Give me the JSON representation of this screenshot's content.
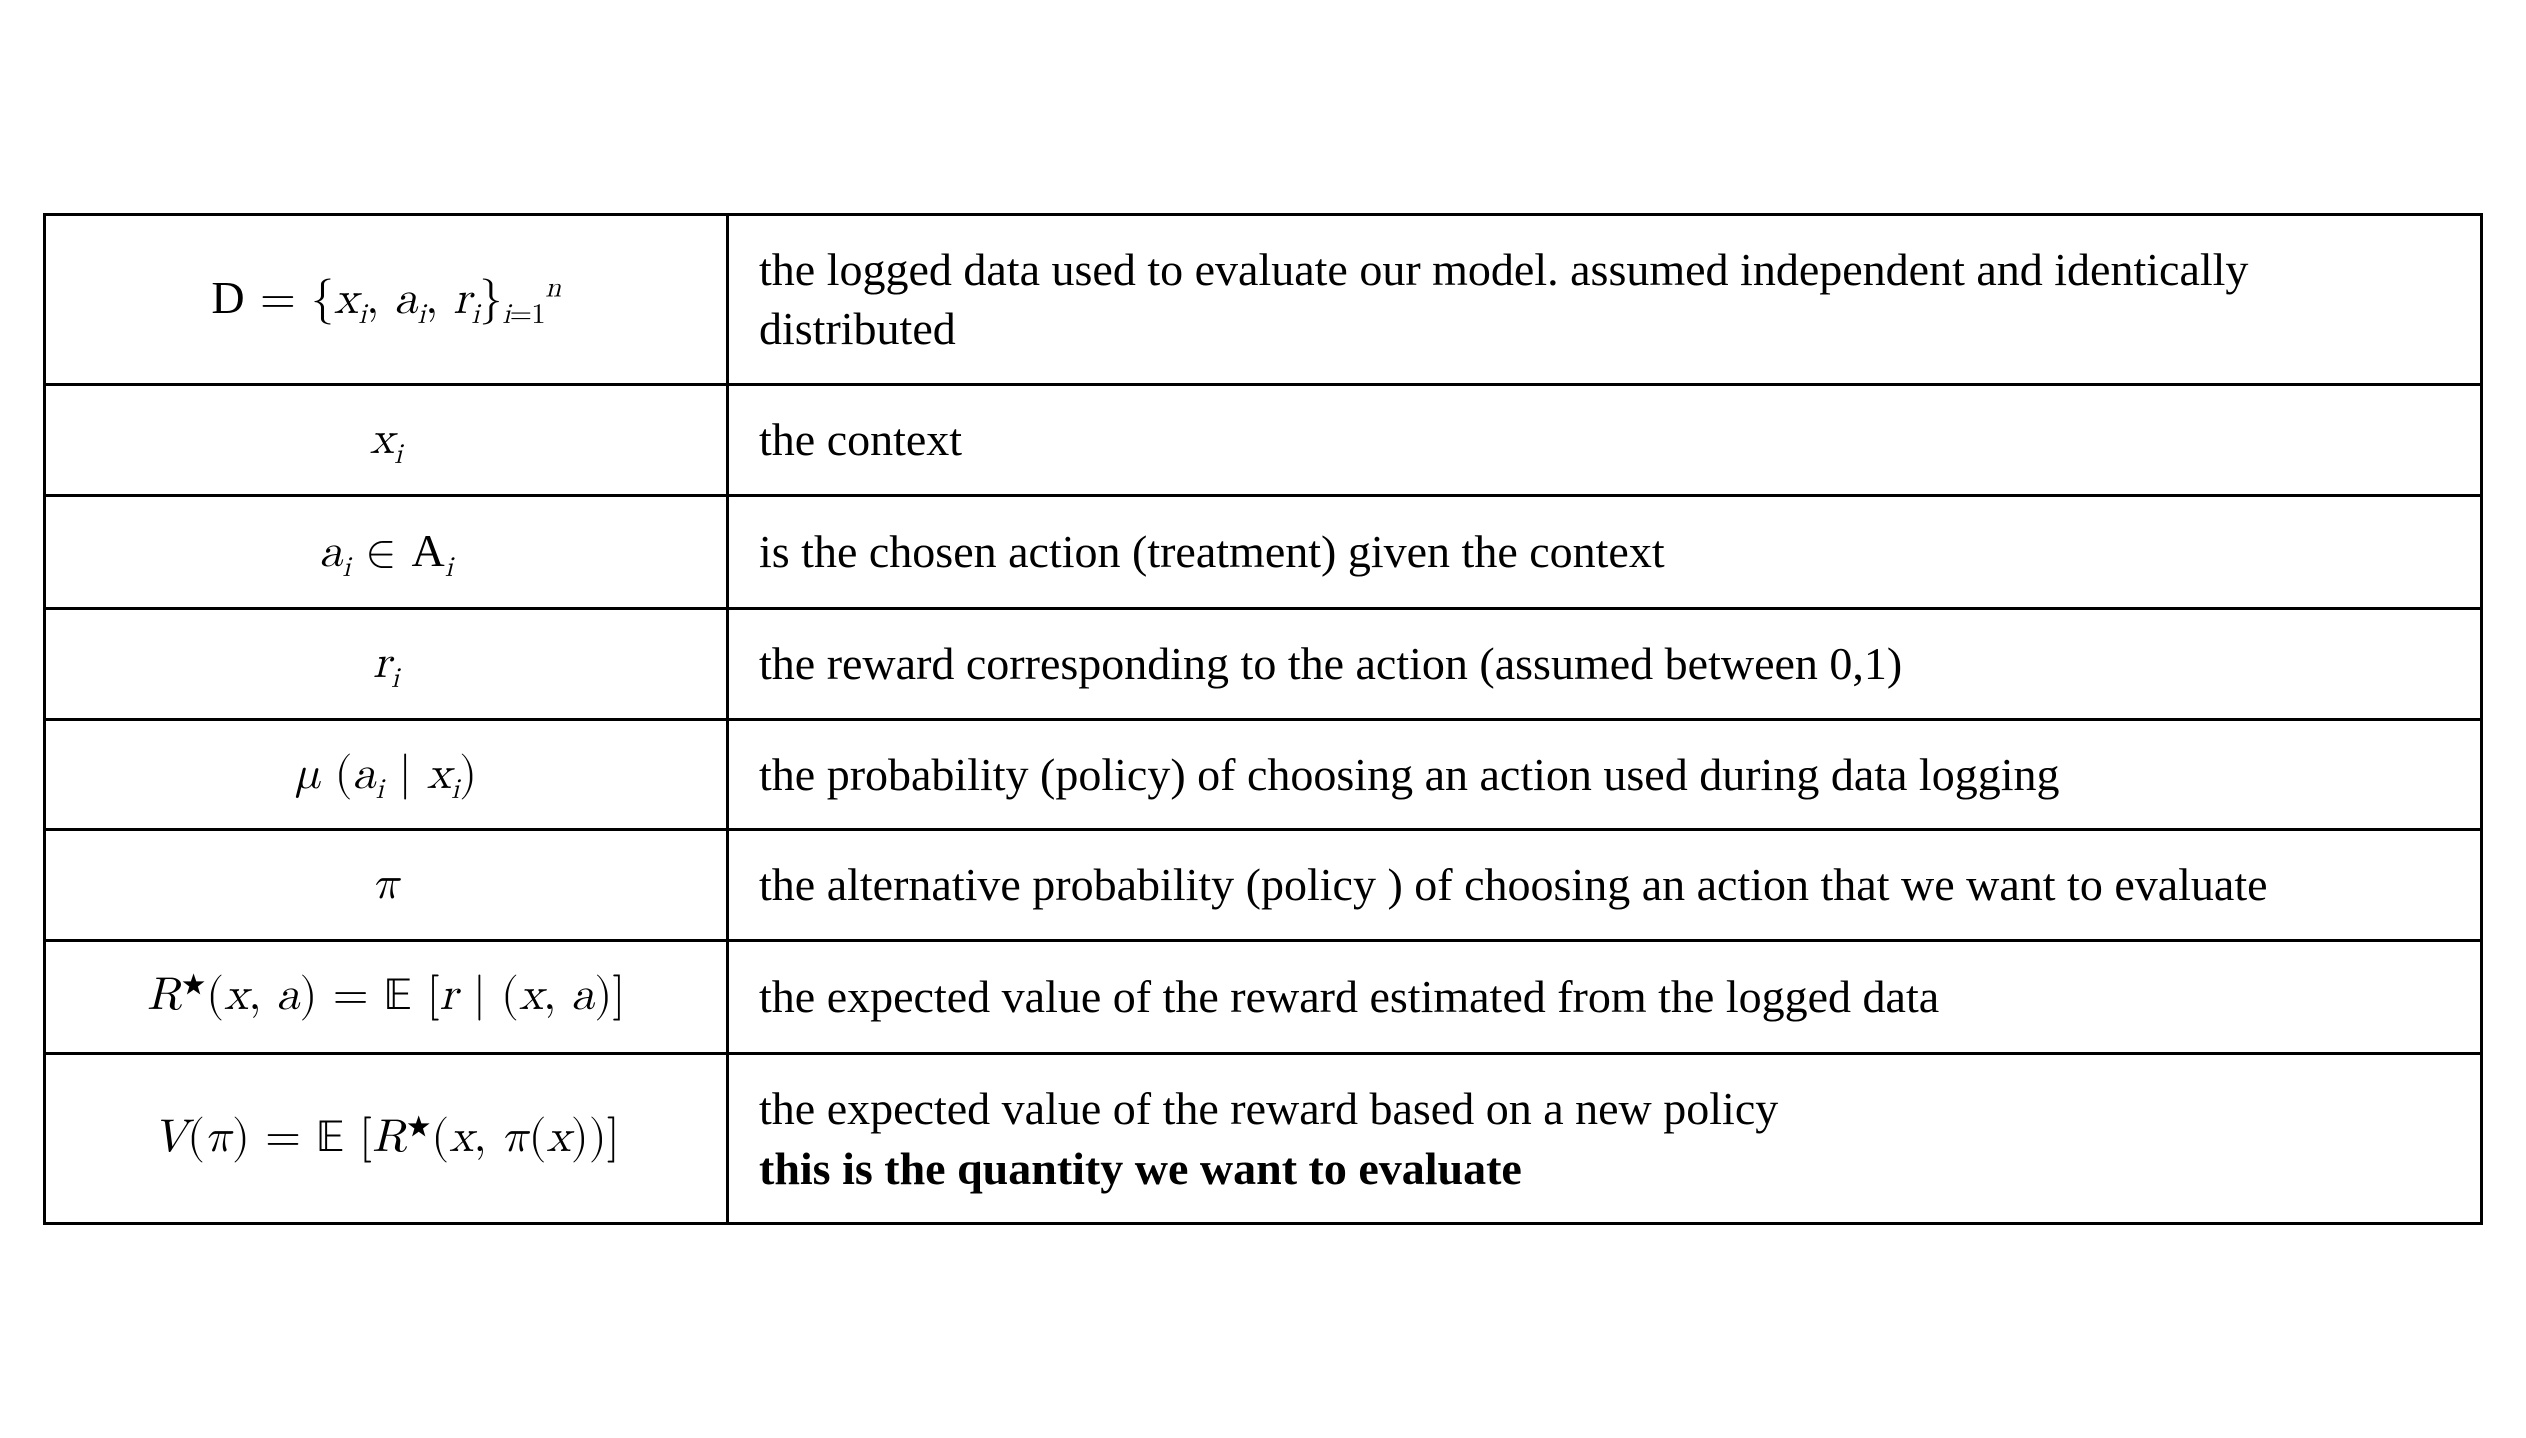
{
  "rows": [
    {
      "symbol_html": "<span class='cal'>D</span>&nbsp;<span class='up'>=</span>&nbsp;<span class='up'>{</span>x<sub>i</sub><span class='up'>,</span>&nbsp;a<sub>i</sub><span class='up'>,</span>&nbsp;r<sub>i</sub><span class='up'>}</span><span class='tight'><sub>i<span class='up'>=1</span></sub><sup>n</sup></span>",
      "description": "the logged data used to evaluate our model. assumed independent and identically distributed"
    },
    {
      "symbol_html": "x<sub>i</sub>",
      "description": "the context"
    },
    {
      "symbol_html": "a<sub>i</sub>&nbsp;<span class='up'>&isin;</span>&nbsp;<span class='cal'>A</span><sub>i</sub>",
      "description": "is the chosen action (treatment) given the context"
    },
    {
      "symbol_html": "r<sub>i</sub>",
      "description": "the reward corresponding to the action (assumed between 0,1)"
    },
    {
      "symbol_html": "&mu;&nbsp;<span class='up'>(</span>a<sub>i</sub>&nbsp;<span class='up'>|</span>&nbsp;x<sub>i</sub><span class='up'>)</span>",
      "description": "the probability (policy) of choosing an action used during data logging"
    },
    {
      "symbol_html": "&pi;",
      "description": "the alternative probability (policy ) of choosing an action that we want to evaluate"
    },
    {
      "symbol_html": "R<sup><span class='up'>&#9733;</span></sup><span class='up'>(</span>x<span class='up'>,</span>&nbsp;a<span class='up'>)</span>&nbsp;<span class='up'>=</span>&nbsp;<span class='bb'>&#120124;</span>&nbsp;<span class='up'>[</span>r&nbsp;<span class='up'>|</span>&nbsp;<span class='up'>(</span>x<span class='up'>,</span>&nbsp;a<span class='up'>)]</span>",
      "description": "the expected value of the reward estimated from the logged data"
    },
    {
      "symbol_html": "V<span class='up'>(</span>&pi;<span class='up'>)</span>&nbsp;<span class='up'>=</span>&nbsp;<span class='bb'>&#120124;</span>&nbsp;<span class='up'>[</span>R<sup><span class='up'>&#9733;</span></sup><span class='up'>(</span>x<span class='up'>,</span>&nbsp;&pi;<span class='up'>(</span>x<span class='up'>))]</span>",
      "description": "the expected value of the reward based on a new policy",
      "bold_suffix": "this is the quantity we want to evaluate"
    }
  ]
}
